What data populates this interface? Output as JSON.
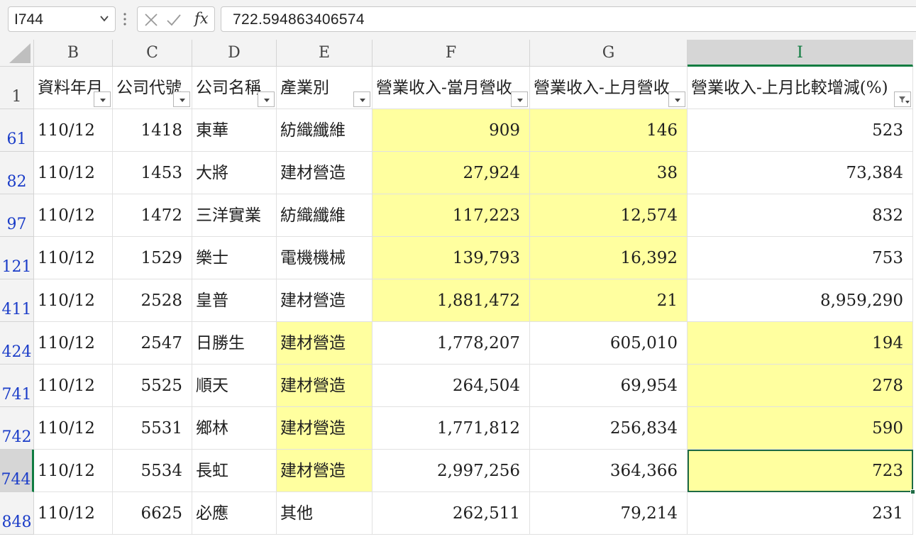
{
  "formula_bar": {
    "name_box": "I744",
    "formula": "722.594863406574",
    "fx_label": "fx"
  },
  "columns": [
    {
      "letter": "B"
    },
    {
      "letter": "C"
    },
    {
      "letter": "D"
    },
    {
      "letter": "E"
    },
    {
      "letter": "F"
    },
    {
      "letter": "G"
    },
    {
      "letter": "I"
    }
  ],
  "header_row": {
    "row_number": "1",
    "cells": [
      "資料年月",
      "公司代號",
      "公司名稱",
      "產業別",
      "營業收入-當月營收",
      "營業收入-上月營收",
      "營業收入-上月比較增減(%)"
    ]
  },
  "rows": [
    {
      "row_number": "61",
      "cells": [
        "110/12",
        "1418",
        "東華",
        "紡織纖維",
        "909",
        "146",
        "523"
      ]
    },
    {
      "row_number": "82",
      "cells": [
        "110/12",
        "1453",
        "大將",
        "建材營造",
        "27,924",
        "38",
        "73,384"
      ]
    },
    {
      "row_number": "97",
      "cells": [
        "110/12",
        "1472",
        "三洋實業",
        "紡織纖維",
        "117,223",
        "12,574",
        "832"
      ]
    },
    {
      "row_number": "121",
      "cells": [
        "110/12",
        "1529",
        "樂士",
        "電機機械",
        "139,793",
        "16,392",
        "753"
      ]
    },
    {
      "row_number": "411",
      "cells": [
        "110/12",
        "2528",
        "皇普",
        "建材營造",
        "1,881,472",
        "21",
        "8,959,290"
      ]
    },
    {
      "row_number": "424",
      "cells": [
        "110/12",
        "2547",
        "日勝生",
        "建材營造",
        "1,778,207",
        "605,010",
        "194"
      ]
    },
    {
      "row_number": "741",
      "cells": [
        "110/12",
        "5525",
        "順天",
        "建材營造",
        "264,504",
        "69,954",
        "278"
      ]
    },
    {
      "row_number": "742",
      "cells": [
        "110/12",
        "5531",
        "鄉林",
        "建材營造",
        "1,771,812",
        "256,834",
        "590"
      ]
    },
    {
      "row_number": "744",
      "cells": [
        "110/12",
        "5534",
        "長虹",
        "建材營造",
        "2,997,256",
        "364,366",
        "723"
      ]
    },
    {
      "row_number": "848",
      "cells": [
        "110/12",
        "6625",
        "必應",
        "其他",
        "262,511",
        "79,214",
        "231"
      ]
    }
  ],
  "selection": {
    "column": "I",
    "row": "744"
  },
  "colors": {
    "highlight": "#ffff9f",
    "selection_accent": "#107c41",
    "filtered_row_number": "#1a3cc8"
  },
  "icons": {
    "name_box_dropdown": "chevron-down-icon",
    "cancel": "x-icon",
    "enter": "check-icon",
    "filter_dropdown": "filter-dropdown-icon",
    "filter_active": "filter-funnel-icon"
  }
}
